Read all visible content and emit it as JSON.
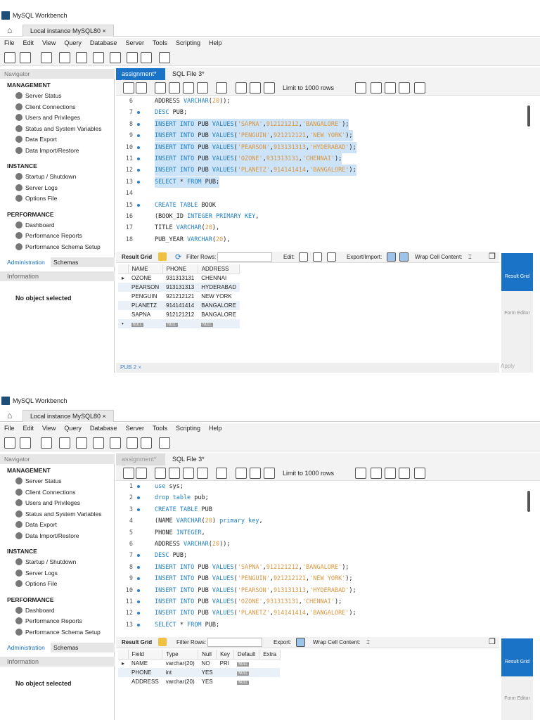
{
  "app_title": "MySQL Workbench",
  "instance_tab": "Local instance MySQL80 ×",
  "menu": [
    "File",
    "Edit",
    "View",
    "Query",
    "Database",
    "Server",
    "Tools",
    "Scripting",
    "Help"
  ],
  "navigator_label": "Navigator",
  "sidebar": {
    "management": "MANAGEMENT",
    "management_items": [
      "Server Status",
      "Client Connections",
      "Users and Privileges",
      "Status and System Variables",
      "Data Export",
      "Data Import/Restore"
    ],
    "instance": "INSTANCE",
    "instance_items": [
      "Startup / Shutdown",
      "Server Logs",
      "Options File"
    ],
    "performance": "PERFORMANCE",
    "performance_items": [
      "Dashboard",
      "Performance Reports",
      "Performance Schema Setup"
    ],
    "tabs": [
      "Administration",
      "Schemas"
    ],
    "information": "Information",
    "no_object": "No object selected"
  },
  "editor_tabs": [
    "assignment* ×",
    "SQL File 3*"
  ],
  "limit_label": "Limit to 1000 rows",
  "result_grid_label": "Result Grid",
  "filter_label": "Filter Rows:",
  "wrap_label": "Wrap Cell Content:",
  "side_result_grid": "Result Grid",
  "side_form_editor": "Form Editor",
  "null_label": "NULL",
  "panels": [
    {
      "active_tab": true,
      "selected_lines": [
        8,
        9,
        10,
        11,
        12,
        13
      ],
      "code": [
        {
          "n": "6",
          "dot": false,
          "t": [
            [
              "ADDRESS ",
              "pl"
            ],
            [
              "VARCHAR",
              "kw"
            ],
            [
              "(",
              "pl"
            ],
            [
              "20",
              "n"
            ],
            [
              "));",
              "pl"
            ]
          ]
        },
        {
          "n": "7",
          "dot": true,
          "t": [
            [
              "DESC ",
              "kw"
            ],
            [
              "PUB;",
              "pl"
            ]
          ]
        },
        {
          "n": "8",
          "dot": true,
          "t": [
            [
              "INSERT INTO ",
              "kw"
            ],
            [
              "PUB ",
              "pl"
            ],
            [
              "VALUES",
              "kw"
            ],
            [
              "(",
              "pl"
            ],
            [
              "'SAPNA'",
              "str"
            ],
            [
              ",",
              "pl"
            ],
            [
              "912121212",
              "n"
            ],
            [
              ",",
              "pl"
            ],
            [
              "'BANGALORE'",
              "str"
            ],
            [
              ");",
              "pl"
            ]
          ]
        },
        {
          "n": "9",
          "dot": true,
          "t": [
            [
              "INSERT INTO ",
              "kw"
            ],
            [
              "PUB ",
              "pl"
            ],
            [
              "VALUES",
              "kw"
            ],
            [
              "(",
              "pl"
            ],
            [
              "'PENGUIN'",
              "str"
            ],
            [
              ",",
              "pl"
            ],
            [
              "921212121",
              "n"
            ],
            [
              ",",
              "pl"
            ],
            [
              "'NEW YORK'",
              "str"
            ],
            [
              ");",
              "pl"
            ]
          ]
        },
        {
          "n": "10",
          "dot": true,
          "t": [
            [
              "INSERT INTO ",
              "kw"
            ],
            [
              "PUB ",
              "pl"
            ],
            [
              "VALUES",
              "kw"
            ],
            [
              "(",
              "pl"
            ],
            [
              "'PEARSON'",
              "str"
            ],
            [
              ",",
              "pl"
            ],
            [
              "913131313",
              "n"
            ],
            [
              ",",
              "pl"
            ],
            [
              "'HYDERABAD'",
              "str"
            ],
            [
              ");",
              "pl"
            ]
          ]
        },
        {
          "n": "11",
          "dot": true,
          "t": [
            [
              "INSERT INTO ",
              "kw"
            ],
            [
              "PUB ",
              "pl"
            ],
            [
              "VALUES",
              "kw"
            ],
            [
              "(",
              "pl"
            ],
            [
              "'OZONE'",
              "str"
            ],
            [
              ",",
              "pl"
            ],
            [
              "931313131",
              "n"
            ],
            [
              ",",
              "pl"
            ],
            [
              "'CHENNAI'",
              "str"
            ],
            [
              ");",
              "pl"
            ]
          ]
        },
        {
          "n": "12",
          "dot": true,
          "t": [
            [
              "INSERT INTO ",
              "kw"
            ],
            [
              "PUB ",
              "pl"
            ],
            [
              "VALUES",
              "kw"
            ],
            [
              "(",
              "pl"
            ],
            [
              "'PLANETZ'",
              "str"
            ],
            [
              ",",
              "pl"
            ],
            [
              "914141414",
              "n"
            ],
            [
              ",",
              "pl"
            ],
            [
              "'BANGALORE'",
              "str"
            ],
            [
              ");",
              "pl"
            ]
          ]
        },
        {
          "n": "13",
          "dot": true,
          "t": [
            [
              "SELECT ",
              "kw"
            ],
            [
              "* ",
              "pl"
            ],
            [
              "FROM ",
              "kw"
            ],
            [
              "PUB;",
              "pl"
            ]
          ]
        },
        {
          "n": "14",
          "dot": false,
          "t": []
        },
        {
          "n": "15",
          "dot": true,
          "t": [
            [
              "CREATE TABLE ",
              "kw"
            ],
            [
              "BOOK",
              "pl"
            ]
          ]
        },
        {
          "n": "16",
          "dot": false,
          "t": [
            [
              "(BOOK_ID ",
              "pl"
            ],
            [
              "INTEGER PRIMARY KEY",
              "kw"
            ],
            [
              ",",
              "pl"
            ]
          ]
        },
        {
          "n": "17",
          "dot": false,
          "t": [
            [
              "TITLE ",
              "pl"
            ],
            [
              "VARCHAR",
              "kw"
            ],
            [
              "(",
              "pl"
            ],
            [
              "20",
              "n"
            ],
            [
              "),",
              "pl"
            ]
          ]
        },
        {
          "n": "18",
          "dot": false,
          "t": [
            [
              "PUB_YEAR ",
              "pl"
            ],
            [
              "VARCHAR",
              "kw"
            ],
            [
              "(",
              "pl"
            ],
            [
              "20",
              "n"
            ],
            [
              "),",
              "pl"
            ]
          ]
        }
      ],
      "toolbar": {
        "edit": "Edit:",
        "export": "Export/Import:"
      },
      "grid": {
        "headers": [
          "NAME",
          "PHONE",
          "ADDRESS"
        ],
        "rows": [
          [
            "OZONE",
            "931313131",
            "CHENNAI"
          ],
          [
            "PEARSON",
            "913131313",
            "HYDERABAD"
          ],
          [
            "PENGUIN",
            "921212121",
            "NEW YORK"
          ],
          [
            "PLANETZ",
            "914141414",
            "BANGALORE"
          ],
          [
            "SAPNA",
            "912121212",
            "BANGALORE"
          ]
        ],
        "null_row": true
      },
      "bottom_tab": "PUB 2 ×",
      "apply": "Apply"
    },
    {
      "active_tab": false,
      "selected_lines": [],
      "code": [
        {
          "n": "1",
          "dot": true,
          "t": [
            [
              "use ",
              "kw"
            ],
            [
              "sys;",
              "pl"
            ]
          ]
        },
        {
          "n": "2",
          "dot": true,
          "t": [
            [
              "drop table ",
              "kw"
            ],
            [
              "pub;",
              "pl"
            ]
          ]
        },
        {
          "n": "3",
          "dot": true,
          "t": [
            [
              "CREATE TABLE ",
              "kw"
            ],
            [
              "PUB",
              "pl"
            ]
          ]
        },
        {
          "n": "4",
          "dot": false,
          "t": [
            [
              "(NAME ",
              "pl"
            ],
            [
              "VARCHAR",
              "kw"
            ],
            [
              "(",
              "pl"
            ],
            [
              "20",
              "n"
            ],
            [
              ") ",
              "pl"
            ],
            [
              "primary key",
              "kw"
            ],
            [
              ",",
              "pl"
            ]
          ]
        },
        {
          "n": "5",
          "dot": false,
          "t": [
            [
              "PHONE ",
              "pl"
            ],
            [
              "INTEGER",
              "kw"
            ],
            [
              ",",
              "pl"
            ]
          ]
        },
        {
          "n": "6",
          "dot": false,
          "t": [
            [
              "ADDRESS ",
              "pl"
            ],
            [
              "VARCHAR",
              "kw"
            ],
            [
              "(",
              "pl"
            ],
            [
              "20",
              "n"
            ],
            [
              "));",
              "pl"
            ]
          ]
        },
        {
          "n": "7",
          "dot": true,
          "t": [
            [
              "DESC ",
              "kw"
            ],
            [
              "PUB;",
              "pl"
            ]
          ]
        },
        {
          "n": "8",
          "dot": true,
          "t": [
            [
              "INSERT INTO ",
              "kw"
            ],
            [
              "PUB ",
              "pl"
            ],
            [
              "VALUES",
              "kw"
            ],
            [
              "(",
              "pl"
            ],
            [
              "'SAPNA'",
              "str"
            ],
            [
              ",",
              "pl"
            ],
            [
              "912121212",
              "n"
            ],
            [
              ",",
              "pl"
            ],
            [
              "'BANGALORE'",
              "str"
            ],
            [
              ");",
              "pl"
            ]
          ]
        },
        {
          "n": "9",
          "dot": true,
          "t": [
            [
              "INSERT INTO ",
              "kw"
            ],
            [
              "PUB ",
              "pl"
            ],
            [
              "VALUES",
              "kw"
            ],
            [
              "(",
              "pl"
            ],
            [
              "'PENGUIN'",
              "str"
            ],
            [
              ",",
              "pl"
            ],
            [
              "921212121",
              "n"
            ],
            [
              ",",
              "pl"
            ],
            [
              "'NEW YORK'",
              "str"
            ],
            [
              ");",
              "pl"
            ]
          ]
        },
        {
          "n": "10",
          "dot": true,
          "t": [
            [
              "INSERT INTO ",
              "kw"
            ],
            [
              "PUB ",
              "pl"
            ],
            [
              "VALUES",
              "kw"
            ],
            [
              "(",
              "pl"
            ],
            [
              "'PEARSON'",
              "str"
            ],
            [
              ",",
              "pl"
            ],
            [
              "913131313",
              "n"
            ],
            [
              ",",
              "pl"
            ],
            [
              "'HYDERABAD'",
              "str"
            ],
            [
              ");",
              "pl"
            ]
          ]
        },
        {
          "n": "11",
          "dot": true,
          "t": [
            [
              "INSERT INTO ",
              "kw"
            ],
            [
              "PUB ",
              "pl"
            ],
            [
              "VALUES",
              "kw"
            ],
            [
              "(",
              "pl"
            ],
            [
              "'OZONE'",
              "str"
            ],
            [
              ",",
              "pl"
            ],
            [
              "931313131",
              "n"
            ],
            [
              ",",
              "pl"
            ],
            [
              "'CHENNAI'",
              "str"
            ],
            [
              ");",
              "pl"
            ]
          ]
        },
        {
          "n": "12",
          "dot": true,
          "t": [
            [
              "INSERT INTO ",
              "kw"
            ],
            [
              "PUB ",
              "pl"
            ],
            [
              "VALUES",
              "kw"
            ],
            [
              "(",
              "pl"
            ],
            [
              "'PLANETZ'",
              "str"
            ],
            [
              ",",
              "pl"
            ],
            [
              "914141414",
              "n"
            ],
            [
              ",",
              "pl"
            ],
            [
              "'BANGALORE'",
              "str"
            ],
            [
              ");",
              "pl"
            ]
          ]
        },
        {
          "n": "13",
          "dot": true,
          "t": [
            [
              "SELECT ",
              "kw"
            ],
            [
              "* ",
              "pl"
            ],
            [
              "FROM ",
              "kw"
            ],
            [
              "PUB;",
              "pl"
            ]
          ]
        }
      ],
      "toolbar": {
        "edit": null,
        "export": "Export:"
      },
      "grid": {
        "headers": [
          "Field",
          "Type",
          "Null",
          "Key",
          "Default",
          "Extra"
        ],
        "rows": [
          [
            "NAME",
            "varchar(20)",
            "NO",
            "PRI",
            "NULL",
            ""
          ],
          [
            "PHONE",
            "int",
            "YES",
            "",
            "NULL",
            ""
          ],
          [
            "ADDRESS",
            "varchar(20)",
            "YES",
            "",
            "NULL",
            ""
          ]
        ],
        "null_row": false
      },
      "bottom_tab": null,
      "apply": null
    }
  ],
  "colors": {
    "accent": "#1a73c7",
    "keyword": "#1f7fc0",
    "string": "#d9963f",
    "selection": "#cde3f7"
  }
}
